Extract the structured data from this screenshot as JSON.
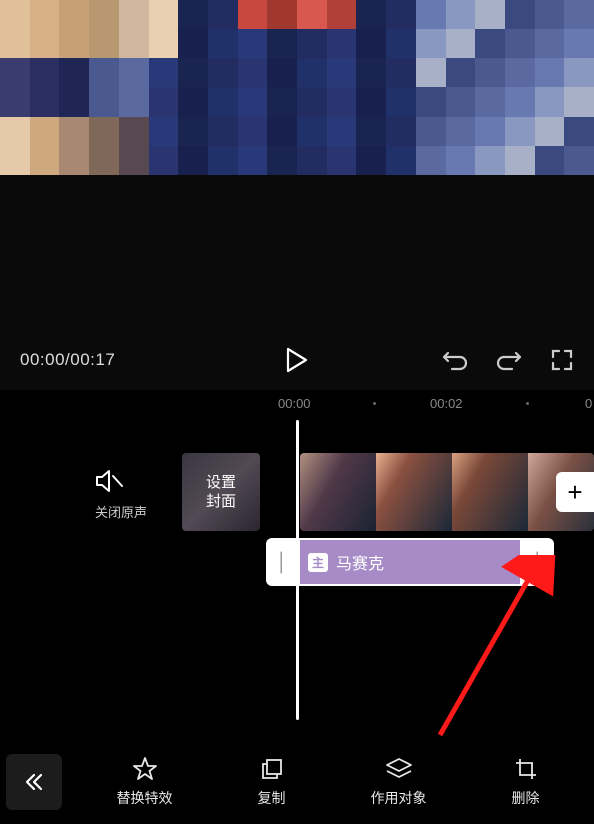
{
  "playback": {
    "current_time": "00:00",
    "total_time": "00:17",
    "combined": "00:00/00:17"
  },
  "ruler": {
    "marks": [
      "00:00",
      "00:02",
      "0"
    ]
  },
  "mute": {
    "label": "关闭原声"
  },
  "cover": {
    "label_line1": "设置",
    "label_line2": "封面"
  },
  "effect": {
    "badge": "主",
    "name": "马赛克"
  },
  "toolbar": {
    "replace_effect": "替换特效",
    "copy": "复制",
    "target": "作用对象",
    "delete": "删除"
  },
  "icons": {
    "mute": "speaker-mute-icon",
    "play": "play-icon",
    "undo": "undo-icon",
    "redo": "redo-icon",
    "fullscreen": "fullscreen-icon",
    "add": "plus-icon",
    "collapse": "chevrons-left-icon",
    "star": "star-icon",
    "copy": "copy-icon",
    "layers": "layers-icon",
    "crop": "crop-icon"
  }
}
